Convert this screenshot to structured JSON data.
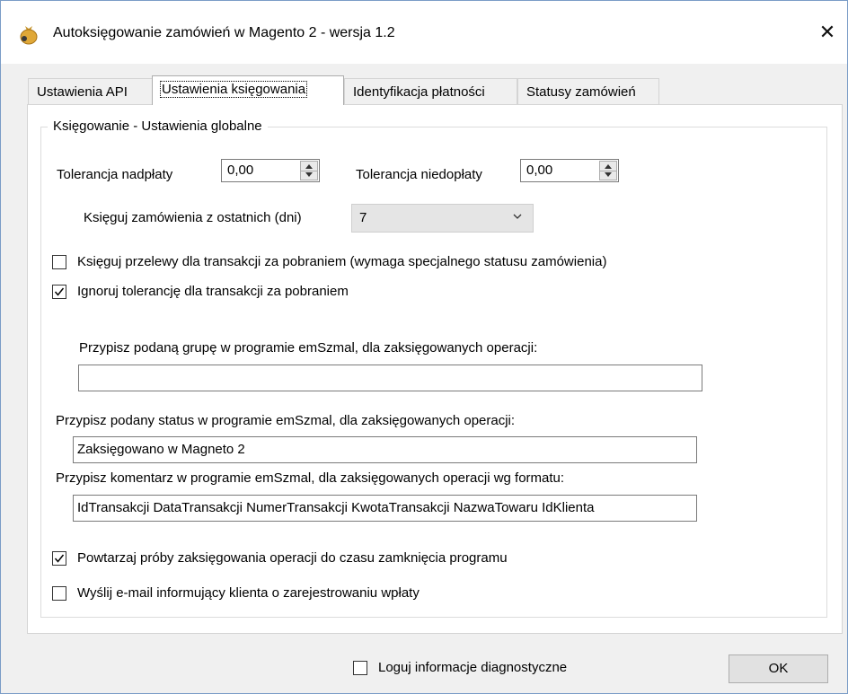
{
  "window": {
    "title": "Autoksięgowanie zamówień w Magento 2 - wersja 1.2",
    "close_glyph": "✕",
    "icon": "money-bag-icon"
  },
  "tabs": [
    {
      "label": "Ustawienia API",
      "active": false
    },
    {
      "label": "Ustawienia księgowania",
      "active": true
    },
    {
      "label": "Identyfikacja płatności",
      "active": false
    },
    {
      "label": "Statusy zamówień",
      "active": false
    }
  ],
  "group": {
    "title": "Księgowanie - Ustawienia globalne"
  },
  "overpayment": {
    "label": "Tolerancja nadpłaty",
    "value": "0,00"
  },
  "underpayment": {
    "label": "Tolerancja niedopłaty",
    "value": "0,00"
  },
  "days": {
    "label": "Księguj zamówienia z ostatnich (dni)",
    "value": "7"
  },
  "checkboxes": {
    "transfers_cod": {
      "label": "Księguj przelewy dla transakcji za pobraniem (wymaga specjalnego statusu zamówienia)",
      "checked": false
    },
    "ignore_tolerance": {
      "label": "Ignoruj tolerancję dla transakcji za pobraniem",
      "checked": true
    },
    "retry": {
      "label": "Powtarzaj próby zaksięgowania operacji do czasu zamknięcia programu",
      "checked": true
    },
    "send_email": {
      "label": "Wyślij e-mail informujący klienta o zarejestrowaniu wpłaty",
      "checked": false
    },
    "log_diagnostics": {
      "label": "Loguj informacje diagnostyczne",
      "checked": false
    }
  },
  "group_field": {
    "label": "Przypisz podaną grupę w programie emSzmal, dla zaksięgowanych operacji:",
    "value": ""
  },
  "status_field": {
    "label": "Przypisz podany status w programie emSzmal, dla zaksięgowanych operacji:",
    "value": "Zaksięgowano w Magneto 2"
  },
  "comment_field": {
    "label": "Przypisz komentarz w programie emSzmal, dla zaksięgowanych operacji wg formatu:",
    "value": "IdTransakcji DataTransakcji NumerTransakcji KwotaTransakcji NazwaTowaru IdKlienta"
  },
  "ok_button": {
    "label": "OK"
  }
}
